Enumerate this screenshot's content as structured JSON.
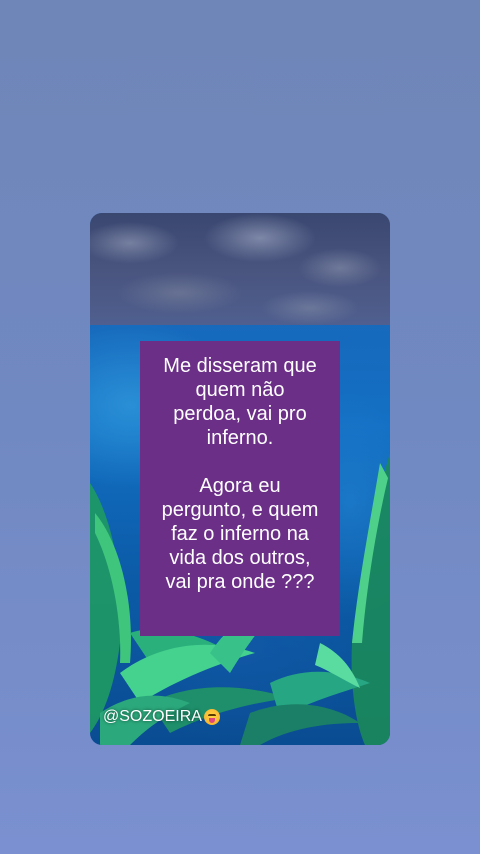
{
  "post": {
    "message": "Me disseram que\nquem não\nperdoa, vai pro\ninferno.\n\nAgora eu\npergunto, e quem\nfaz o inferno na\nvida dos outros,\nvai pra onde ???",
    "handle": "@SOZOEIRA",
    "handle_emoji": "squinting-face-with-tongue-icon"
  },
  "colors": {
    "page_background": "#7189c2",
    "text_box": "#6c2f88",
    "text": "#ffffff"
  }
}
